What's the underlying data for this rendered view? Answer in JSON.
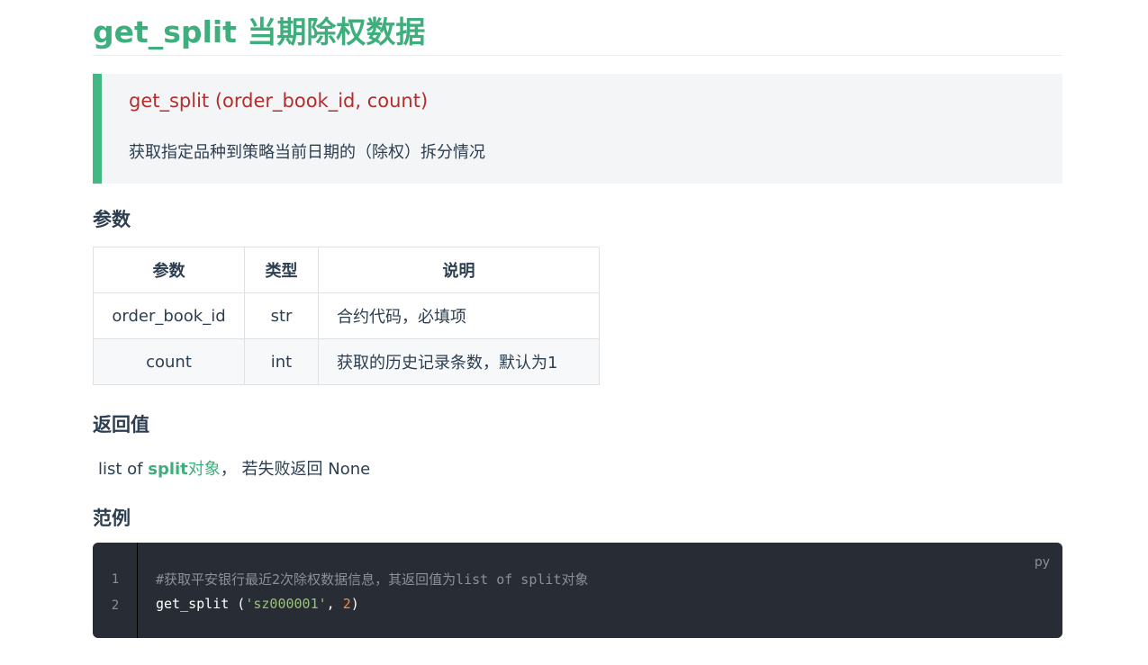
{
  "title": "get_split 当期除权数据",
  "signature": {
    "text": "get_split (order_book_id, count)",
    "description": "获取指定品种到策略当前日期的（除权）拆分情况"
  },
  "params_section": {
    "heading": "参数",
    "table": {
      "headers": [
        "参数",
        "类型",
        "说明"
      ],
      "rows": [
        {
          "name": "order_book_id",
          "type": "str",
          "desc": "合约代码，必填项"
        },
        {
          "name": "count",
          "type": "int",
          "desc": "获取的历史记录条数，默认为1"
        }
      ]
    }
  },
  "return_section": {
    "heading": "返回值",
    "prefix": "list of ",
    "link_bold": "split",
    "link_rest": "对象",
    "suffix": "， 若失败返回 None"
  },
  "example_section": {
    "heading": "范例",
    "language": "py",
    "line_numbers": [
      "1",
      "2"
    ],
    "comment_line": "#获取平安银行最近2次除权数据信息，其返回值为list of split对象",
    "call": {
      "func": "get_split (",
      "arg_str": "'sz000001'",
      "sep": ", ",
      "arg_num": "2",
      "close": ")"
    }
  }
}
